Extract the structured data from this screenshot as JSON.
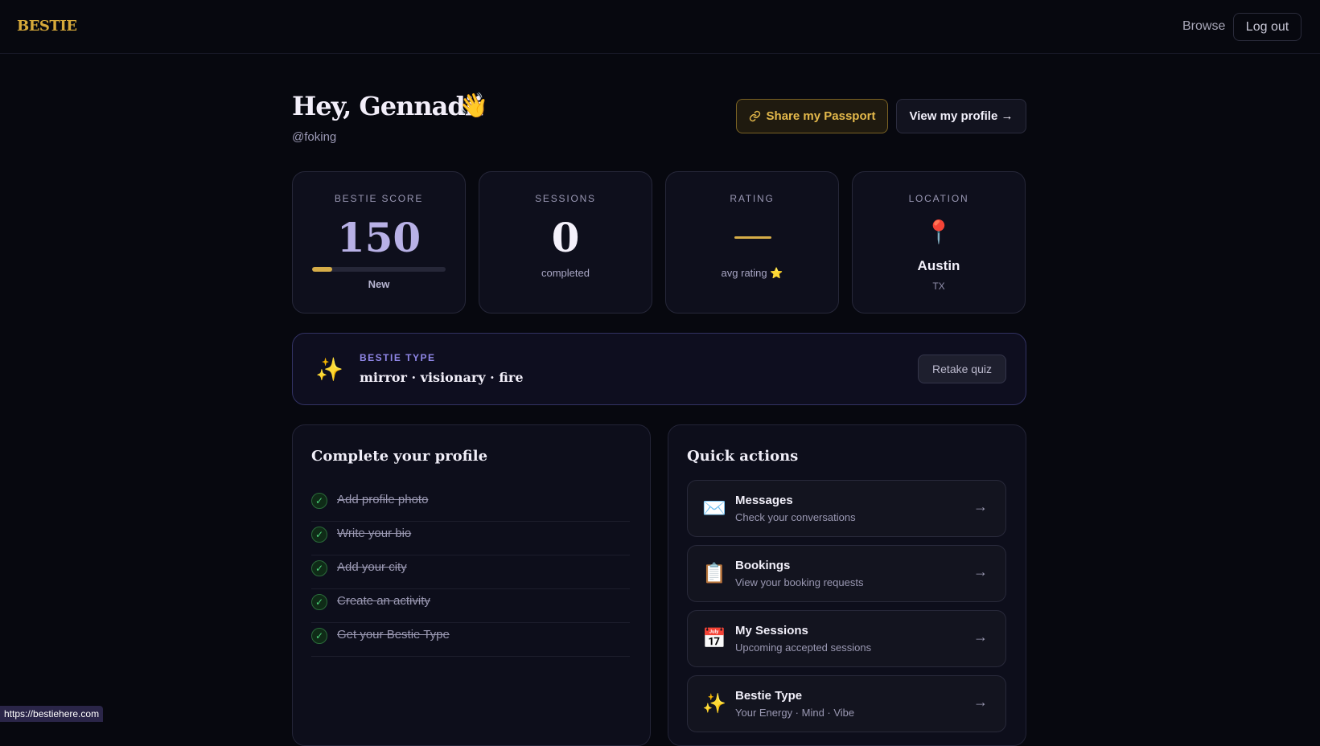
{
  "header": {
    "logo": "BESTIE",
    "browse_label": "Browse",
    "logout_label": "Log out"
  },
  "greeting": {
    "title": "Hey, Gennadii",
    "wave_emoji": "👋",
    "handle": "@foking"
  },
  "actions": {
    "share_label": "Share my Passport",
    "share_icon": "link-icon",
    "profile_label": "View my profile →"
  },
  "stats": {
    "score": {
      "label": "BESTIE SCORE",
      "value": "150",
      "level": "New",
      "progress": 0.15
    },
    "sessions": {
      "label": "SESSIONS",
      "value": "0",
      "sub": "completed"
    },
    "rating": {
      "label": "RATING",
      "sub": "avg rating ⭐"
    },
    "location": {
      "label": "LOCATION",
      "icon": "📍",
      "city": "Austin",
      "state": "TX"
    }
  },
  "bestie_type": {
    "icon": "✨",
    "label": "BESTIE TYPE",
    "value": "mirror · visionary · fire",
    "retake_label": "Retake quiz"
  },
  "complete_profile": {
    "title": "Complete your profile",
    "items": [
      {
        "label": "Add profile photo",
        "done": true
      },
      {
        "label": "Write your bio",
        "done": true
      },
      {
        "label": "Add your city",
        "done": true
      },
      {
        "label": "Create an activity",
        "done": true
      },
      {
        "label": "Get your Bestie Type",
        "done": true
      }
    ]
  },
  "quick_actions": {
    "title": "Quick actions",
    "items": [
      {
        "icon": "✉️",
        "title": "Messages",
        "sub": "Check your conversations"
      },
      {
        "icon": "📋",
        "title": "Bookings",
        "sub": "View your booking requests"
      },
      {
        "icon": "📅",
        "title": "My Sessions",
        "sub": "Upcoming accepted sessions"
      },
      {
        "icon": "✨",
        "title": "Bestie Type",
        "sub": "Your Energy · Mind · Vibe"
      }
    ],
    "arrow": "→"
  },
  "status_bar": {
    "url": "https://bestiehere.com"
  },
  "colors": {
    "gold": "#d6ad48",
    "accent_purple": "#8f86e6",
    "background": "#07080f"
  }
}
